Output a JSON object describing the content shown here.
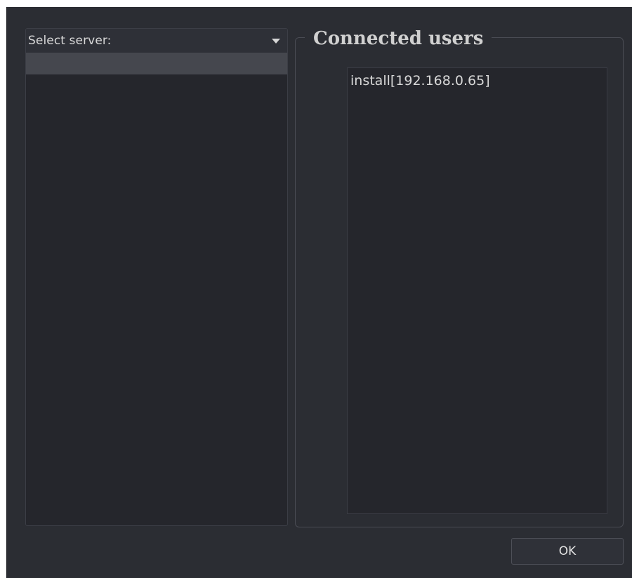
{
  "server_panel": {
    "select_label": "Select server:",
    "dropdown_icon": "chevron-down-icon",
    "rows": [
      ""
    ]
  },
  "connected_users": {
    "title": "Connected users",
    "users": [
      "install[192.168.0.65]"
    ]
  },
  "footer": {
    "ok_label": "OK"
  },
  "colors": {
    "window_bg": "#2b2d33",
    "panel_bg": "#25262c",
    "selected_row": "#45474e",
    "text": "#d8d8d8"
  }
}
